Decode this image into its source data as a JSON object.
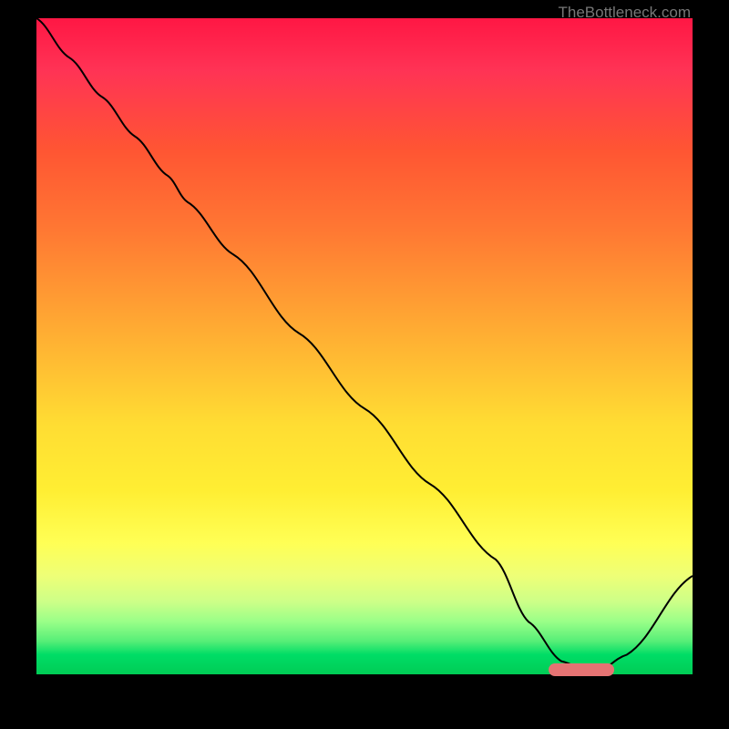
{
  "watermark": "TheBottleneck.com",
  "chart_data": {
    "type": "line",
    "x": [
      0,
      5,
      10,
      15,
      20,
      23,
      30,
      40,
      50,
      60,
      70,
      75,
      80,
      85,
      90,
      100
    ],
    "values": [
      100,
      94,
      88,
      82,
      76,
      72,
      64,
      52,
      40.5,
      29,
      17.5,
      8,
      2,
      0,
      3,
      15
    ],
    "xlim": [
      0,
      100
    ],
    "ylim": [
      0,
      100
    ],
    "marker": {
      "x_start": 78,
      "x_end": 88,
      "y": 0
    }
  }
}
